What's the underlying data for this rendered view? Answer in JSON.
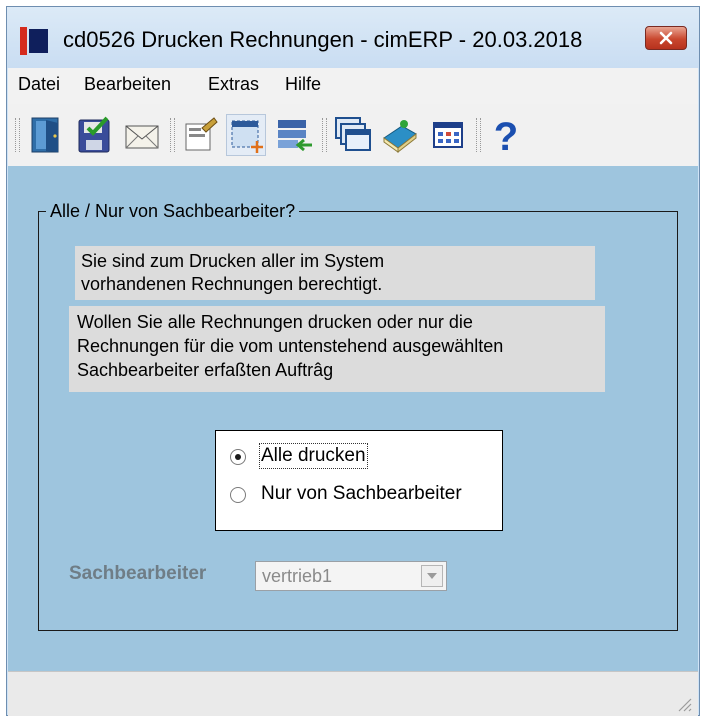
{
  "window": {
    "title": "cd0526 Drucken Rechnungen - cimERP - 20.03.2018",
    "close_icon": "close-icon"
  },
  "menu": [
    "Datei",
    "Bearbeiten",
    "Extras",
    "Hilfe"
  ],
  "toolbar": {
    "buttons": [
      "exit-door-icon",
      "save-disk-icon",
      "email-envelope-icon",
      "edit-form-icon",
      "new-record-icon",
      "import-list-icon",
      "windows-icon",
      "book-icon",
      "grid-calendar-icon",
      "help-question-icon"
    ]
  },
  "group": {
    "legend": "Alle / Nur von Sachbearbeiter?",
    "info_line1": "Sie sind zum Drucken aller im System",
    "info_line2": "vorhandenen Rechnungen berechtigt.",
    "question_line1": "Wollen Sie alle Rechnungen drucken oder nur die",
    "question_line2": "Rechnungen für die vom untenstehend ausgewählten",
    "question_line3": "Sachbearbeiter erfaßten Auftrâg"
  },
  "radio": {
    "options": [
      "Alle drucken",
      "Nur von Sachbearbeiter"
    ],
    "selected_index": 0
  },
  "sachbearbeiter": {
    "label": "Sachbearbeiter",
    "value": "vertrieb1",
    "enabled": false
  },
  "colors": {
    "client_bg": "#9ec5de",
    "info_bg": "#dcdcdc",
    "disabled_label": "#6f7d86"
  }
}
